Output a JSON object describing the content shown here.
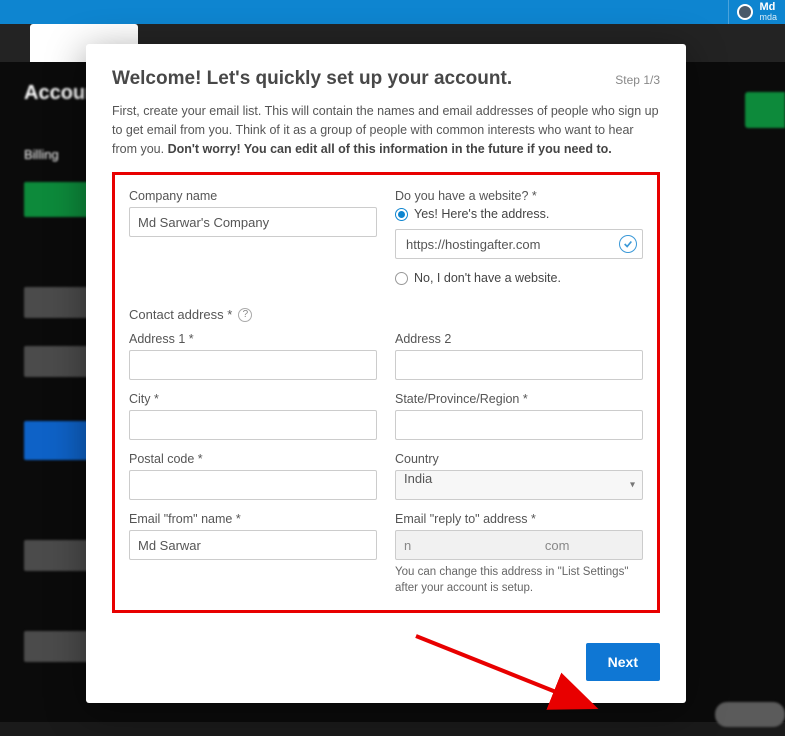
{
  "topbar": {
    "user_name": "Md",
    "user_sub": "mda"
  },
  "modal": {
    "title": "Welcome! Let's quickly set up your account.",
    "step": "Step 1/3",
    "desc_plain": "First, create your email list. This will contain the names and email addresses of people who sign up to get email from you. Think of it as a group of people with common interests who want to hear from you. ",
    "desc_bold": "Don't worry! You can edit all of this information in the future if you need to."
  },
  "form": {
    "company_label": "Company name",
    "company_value": "Md Sarwar's Company",
    "website_q": "Do you have a website? *",
    "website_yes_label": "Yes! Here's the address.",
    "website_value": "https://hostingafter.com",
    "website_no_label": "No, I don't have a website.",
    "contact_section": "Contact address *",
    "address1_label": "Address 1 *",
    "address1_value": "",
    "address2_label": "Address 2",
    "address2_value": "",
    "city_label": "City *",
    "city_value": "",
    "state_label": "State/Province/Region *",
    "state_value": "",
    "postal_label": "Postal code *",
    "postal_value": "",
    "country_label": "Country",
    "country_value": "India",
    "from_name_label": "Email \"from\" name *",
    "from_name_value": "Md Sarwar",
    "reply_to_label": "Email \"reply to\" address *",
    "reply_to_value": "n                                     com",
    "reply_hint": "You can change this address in \"List Settings\" after your account is setup."
  },
  "footer": {
    "next": "Next"
  }
}
